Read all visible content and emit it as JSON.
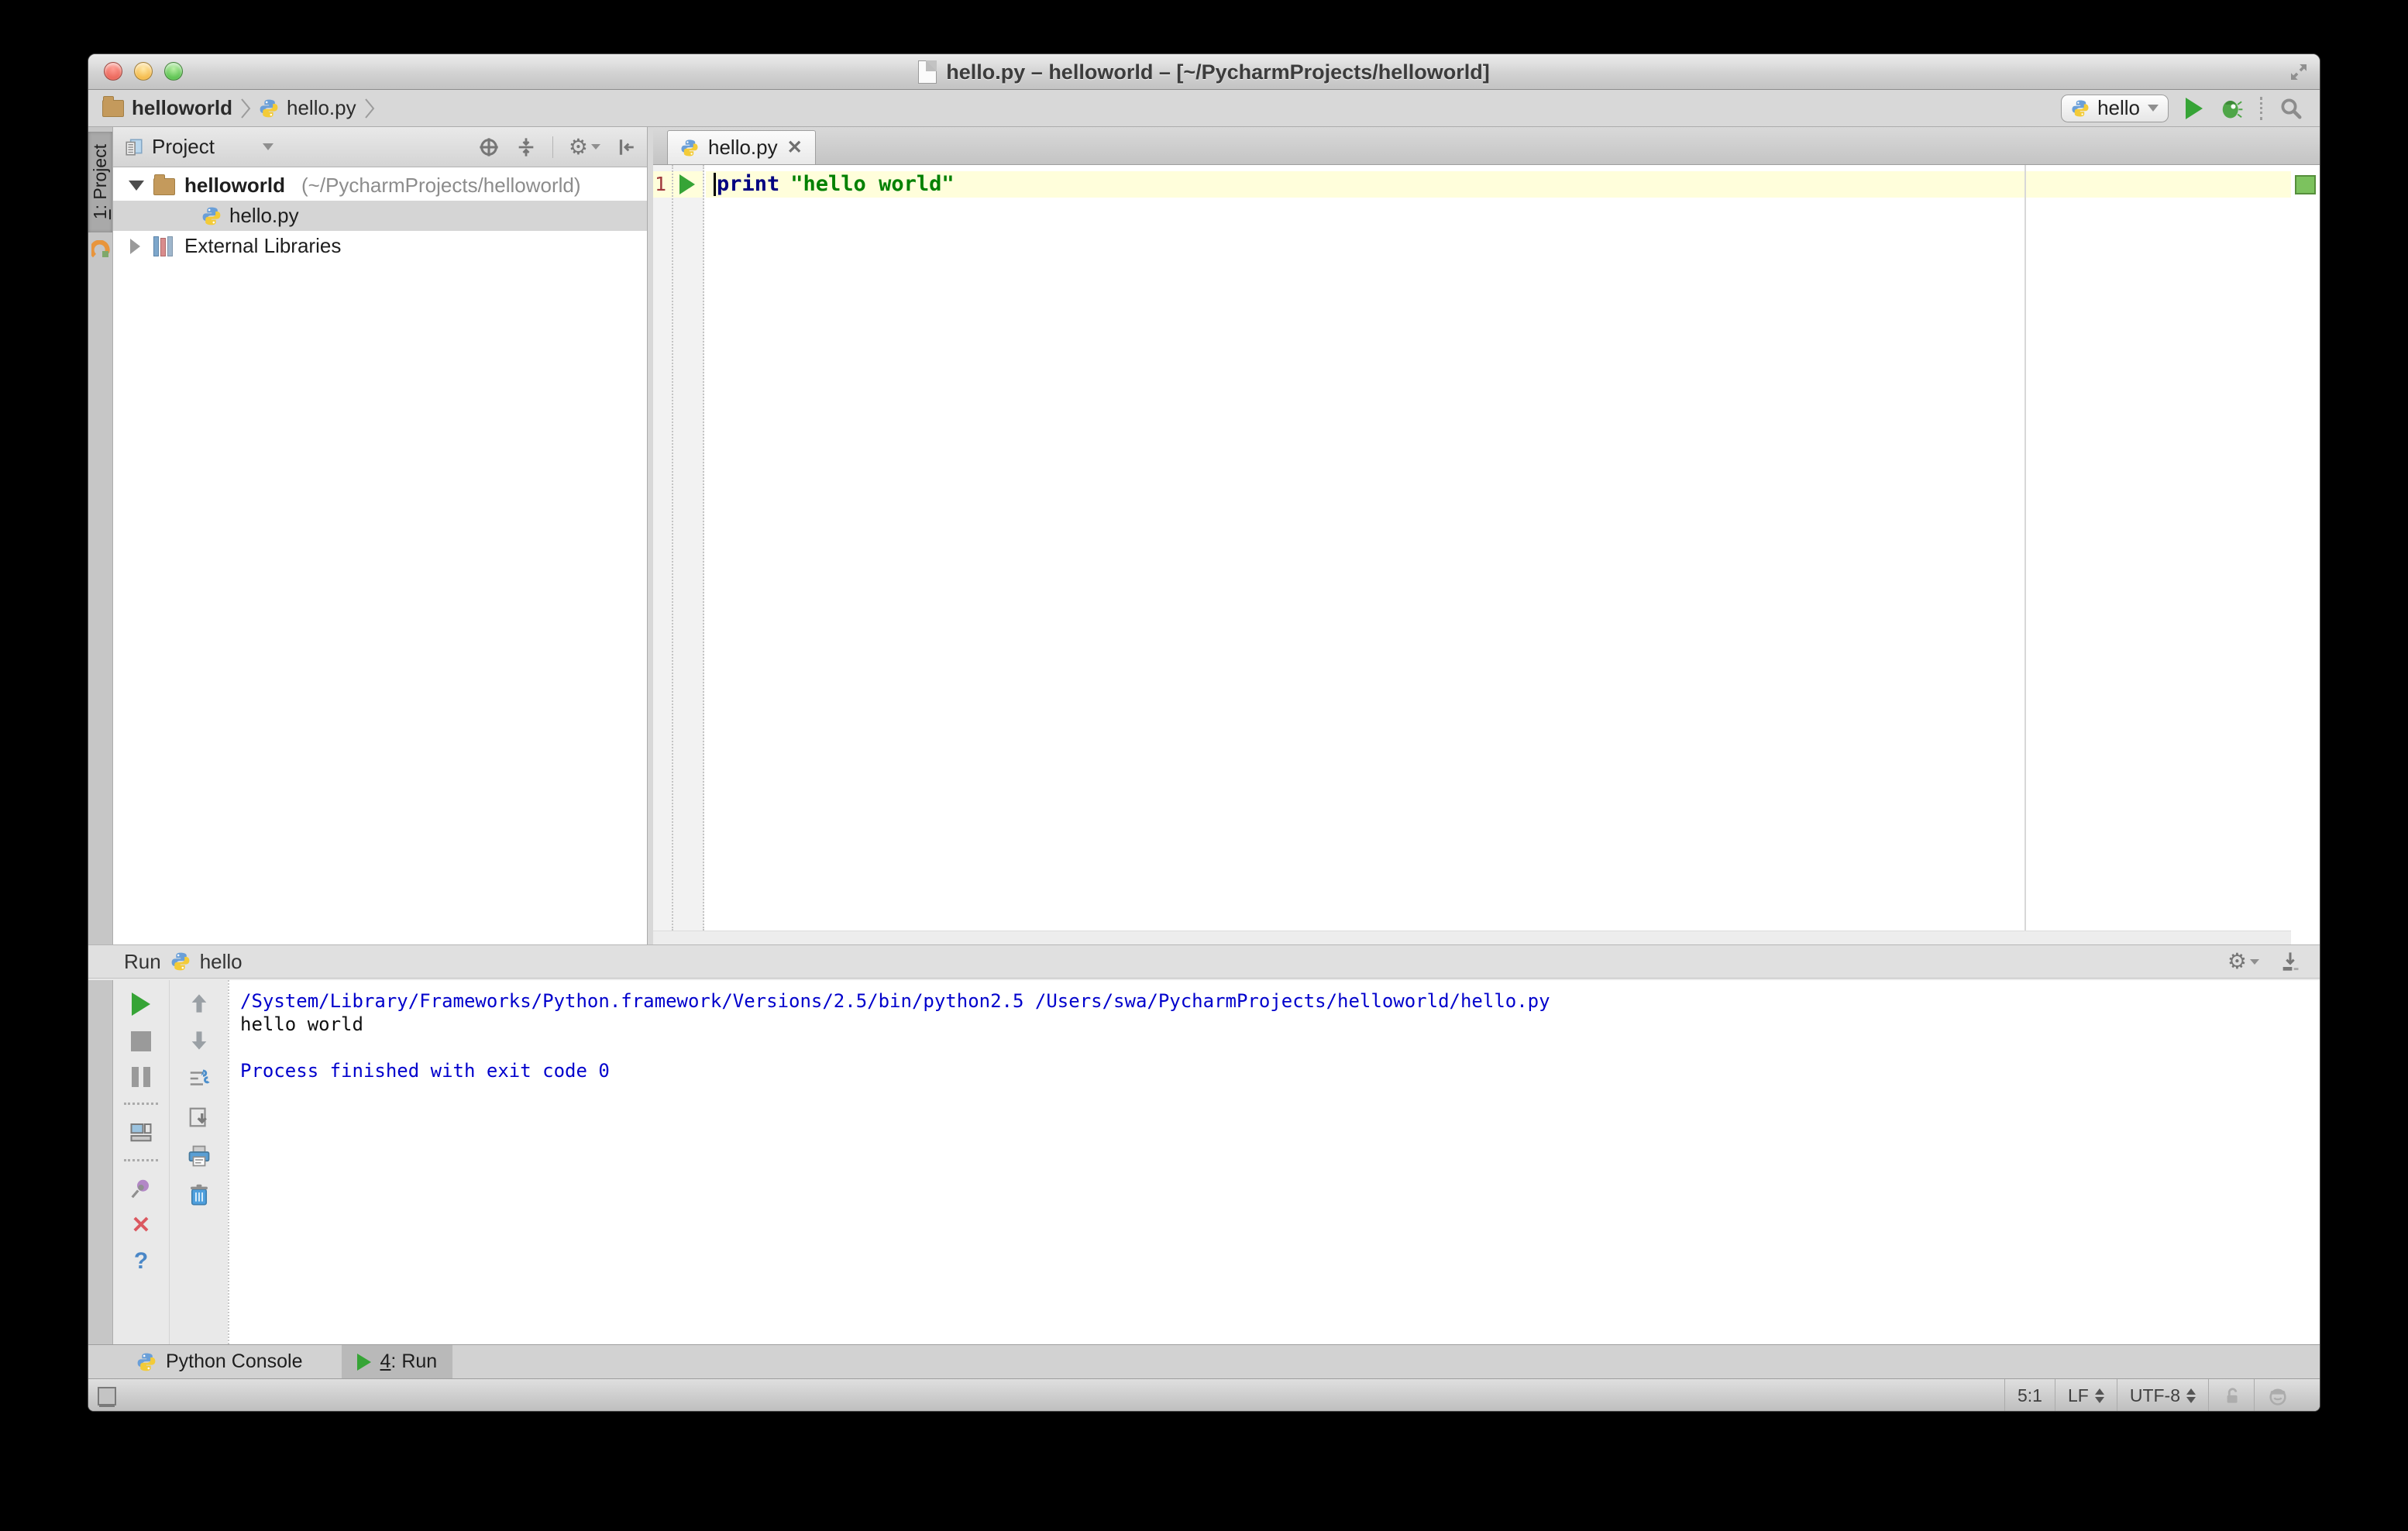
{
  "window": {
    "title": "hello.py – helloworld – [~/PycharmProjects/helloworld]"
  },
  "toolbar": {
    "breadcrumb": [
      {
        "label": "helloworld"
      },
      {
        "label": "hello.py"
      }
    ],
    "run_config": "hello"
  },
  "tool_stripe": {
    "project_num": "1",
    "project_rest": ": Project"
  },
  "project_panel": {
    "header": "Project",
    "tree": [
      {
        "name": "helloworld",
        "path": "(~/PycharmProjects/helloworld)"
      },
      {
        "name": "hello.py"
      },
      {
        "name": "External Libraries"
      }
    ]
  },
  "editor": {
    "tab_label": "hello.py",
    "close_glyph": "✕",
    "line_number": "1",
    "code": {
      "keyword": "print",
      "string": "\"hello world\""
    }
  },
  "run_panel": {
    "title": "Run",
    "config": "hello",
    "console": [
      {
        "text": "/System/Library/Frameworks/Python.framework/Versions/2.5/bin/python2.5 /Users/swa/PycharmProjects/helloworld/hello.py"
      },
      {
        "text": "hello world"
      },
      {
        "text": " "
      },
      {
        "text": "Process finished with exit code 0"
      }
    ]
  },
  "bottom_bar": {
    "python_console_label": "Python Console",
    "run_tab_num": "4",
    "run_tab_rest": ": Run"
  },
  "status_bar": {
    "caret_position": "5:1",
    "line_ending": "LF",
    "encoding": "UTF-8"
  },
  "icons": [
    "document-icon",
    "window-resize-icon",
    "folder-icon",
    "python-icon",
    "chevron-icon",
    "run-icon",
    "debug-bug-icon",
    "search-icon",
    "project-view-icon",
    "locate-icon",
    "collapse-all-icon",
    "gear-icon",
    "hide-panel-icon",
    "expand-arrow-icon",
    "collapse-arrow-icon",
    "external-libraries-icon",
    "close-icon",
    "rerun-icon",
    "stop-icon",
    "pause-icon",
    "restore-layout-icon",
    "pin-icon",
    "help-icon",
    "up-arrow-icon",
    "down-arrow-icon",
    "soft-wrap-icon",
    "scroll-to-end-icon",
    "print-icon",
    "clear-icon",
    "dock-icon",
    "unlock-icon",
    "hector-icon",
    "pycharm-logo-icon",
    "grip-icon"
  ],
  "colors": {
    "keyword": "#000080",
    "string": "#008000",
    "console_system": "#0000CC",
    "run_green": "#36A436",
    "current_line": "#FFFEDB",
    "line_number": "#A0393C",
    "selection": "#D5D5D5",
    "ok_indicator": "#7CC25E",
    "error_red": "#DB5860",
    "help_blue": "#4A87C7",
    "folder_tan": "#C49A5C"
  }
}
